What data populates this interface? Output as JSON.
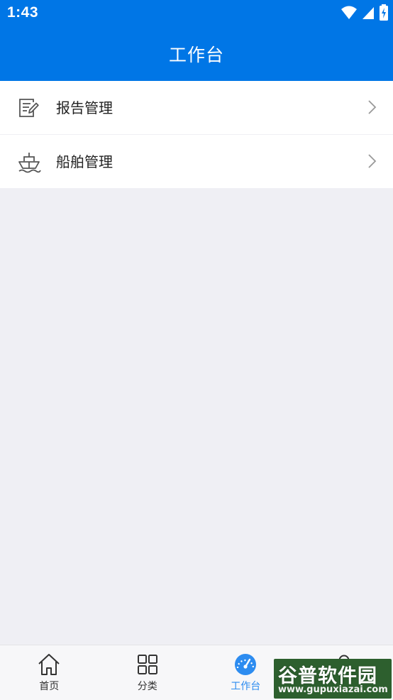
{
  "status_bar": {
    "time": "1:43",
    "icons": [
      "wifi-icon",
      "signal-icon",
      "battery-charging-icon"
    ]
  },
  "header": {
    "title": "工作台"
  },
  "menu": {
    "items": [
      {
        "label": "报告管理",
        "icon": "report-edit-icon"
      },
      {
        "label": "船舶管理",
        "icon": "ship-icon"
      }
    ]
  },
  "tab_bar": {
    "tabs": [
      {
        "label": "首页",
        "icon": "home-icon",
        "active": false
      },
      {
        "label": "分类",
        "icon": "grid-icon",
        "active": false
      },
      {
        "label": "工作台",
        "icon": "dashboard-icon",
        "active": true
      },
      {
        "label": "",
        "icon": "user-icon",
        "active": false
      }
    ]
  },
  "watermark": {
    "title": "谷普软件园",
    "url": "www.gupuxiazai.com"
  },
  "colors": {
    "primary": "#0076e6",
    "active_tab": "#2d8cf0",
    "page_background": "#efeff4"
  }
}
